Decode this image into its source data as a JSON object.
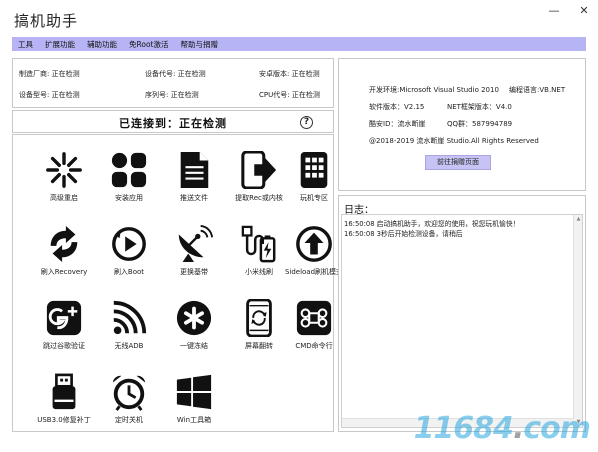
{
  "window": {
    "title": "搞机助手",
    "controls": {
      "minimize": "—",
      "close": "✕"
    }
  },
  "menu": [
    "工具",
    "扩展功能",
    "辅助功能",
    "免Root激活",
    "帮助与捐赠"
  ],
  "device_info": [
    {
      "label": "制造厂商: 正在检测"
    },
    {
      "label": "设备代号: 正在检测"
    },
    {
      "label": "安卓版本: 正在检测"
    },
    {
      "label": "设备型号: 正在检测"
    },
    {
      "label": "序列号: 正在检测"
    },
    {
      "label": "CPU代号: 正在检测"
    }
  ],
  "connection": {
    "status": "已连接到：正在检测",
    "help": "?"
  },
  "tools": [
    {
      "label": "高级重启",
      "icon": "burst-icon"
    },
    {
      "label": "安装应用",
      "icon": "apps-grid-icon"
    },
    {
      "label": "推送文件",
      "icon": "document-icon"
    },
    {
      "label": "提取Rec或内核",
      "icon": "phone-export-icon"
    },
    {
      "label": "玩机专区",
      "icon": "tablet-grid-icon"
    },
    {
      "label": "刷入Recovery",
      "icon": "recycle-arrows-icon"
    },
    {
      "label": "刷入Boot",
      "icon": "play-circle-icon"
    },
    {
      "label": "更换基带",
      "icon": "satellite-dish-icon"
    },
    {
      "label": "小米线刷",
      "icon": "usb-battery-icon"
    },
    {
      "label": "Sideload刷机模式",
      "icon": "upload-circle-icon"
    },
    {
      "label": "跳过谷歌验证",
      "icon": "google-plus-icon"
    },
    {
      "label": "无线ADB",
      "icon": "wifi-icon"
    },
    {
      "label": "一键冻结",
      "icon": "asterisk-circle-icon"
    },
    {
      "label": "屏幕翻转",
      "icon": "phone-rotate-icon"
    },
    {
      "label": "CMD命令行",
      "icon": "command-key-icon"
    },
    {
      "label": "USB3.0修复补丁",
      "icon": "usb-drive-icon"
    },
    {
      "label": "定时关机",
      "icon": "alarm-clock-icon"
    },
    {
      "label": "Win工具箱",
      "icon": "windows-logo-icon"
    }
  ],
  "about": {
    "env": "开发环境:Microsoft Visual Studio 2010",
    "lang": "编程语言:VB.NET",
    "version": "软件版本：V2.15",
    "framework": "NET框架版本：V4.0",
    "coolapk": "酷安ID：流水断崖",
    "qq": "QQ群：587994789",
    "copyright": "@2018-2019   流水断崖 Studio.All Rights Reserved",
    "site_button": "前往捐赠页面"
  },
  "log": {
    "title": "日志：",
    "lines": [
      "16:50:08 启动搞机助手，欢迎您的使用，祝您玩机愉快！",
      "16:50:08 3秒后开始检测设备，请稍后"
    ]
  },
  "watermark": {
    "left": "11684",
    "sep": ".",
    "right": "com"
  },
  "colors": {
    "menu_bg": "#b6b4f4",
    "button_bg": "#c7c4f5",
    "icon": "#111111"
  }
}
